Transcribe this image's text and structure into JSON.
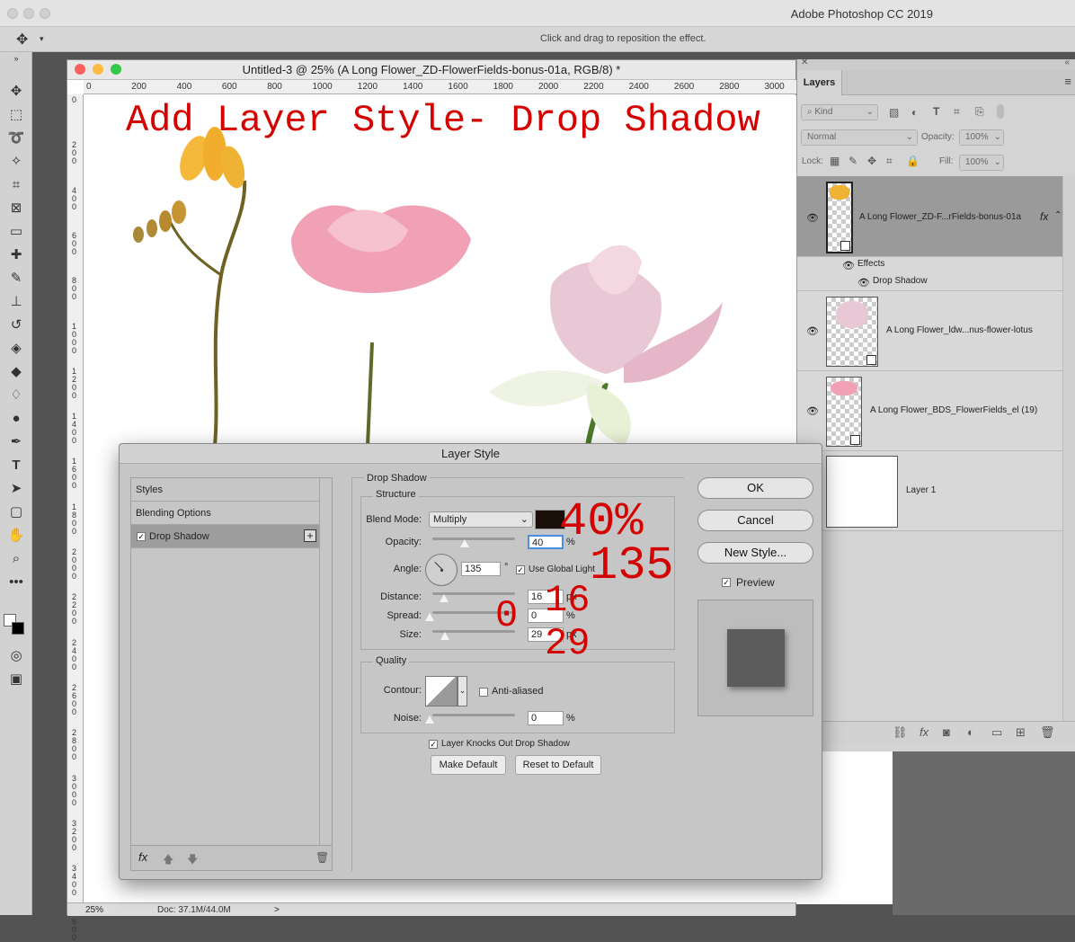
{
  "app": {
    "title": "Adobe Photoshop CC 2019"
  },
  "options_bar": {
    "hint": "Click and drag to reposition the effect."
  },
  "document": {
    "title": "Untitled-3 @ 25% (A Long Flower_ZD-FlowerFields-bonus-01a, RGB/8) *",
    "ruler_h": [
      "0",
      "200",
      "400",
      "600",
      "800",
      "1000",
      "1200",
      "1400",
      "1600",
      "1800",
      "2000",
      "2200",
      "2400",
      "2600",
      "2800",
      "3000"
    ],
    "ruler_v": [
      "0",
      "2 0 0",
      "4 0 0",
      "6 0 0",
      "8 0 0",
      "1 0 0 0",
      "1 2 0 0",
      "1 4 0 0",
      "1 6 0 0",
      "1 8 0 0",
      "2 0 0 0",
      "2 2 0 0",
      "2 4 0 0",
      "2 6 0 0",
      "2 8 0 0",
      "3 0 0 0",
      "3 2 0 0",
      "3 4 0 0",
      "3 6 0 0"
    ],
    "canvas_title": "Add Layer Style- Drop Shadow",
    "zoom": "25%",
    "doc_info": "Doc: 37.1M/44.0M",
    "status_arrow": ">"
  },
  "layers_panel": {
    "tab": "Layers",
    "filter_kind": "Kind",
    "blend_mode": "Normal",
    "opacity_label": "Opacity:",
    "opacity_value": "100%",
    "lock_label": "Lock:",
    "fill_label": "Fill:",
    "fill_value": "100%",
    "layers": [
      {
        "name": "A Long Flower_ZD-F...rFields-bonus-01a",
        "fx": "fx",
        "selected": true
      },
      {
        "name": "A Long Flower_ldw...nus-flower-lotus"
      },
      {
        "name": "A Long Flower_BDS_FlowerFields_el (19)"
      },
      {
        "name": "Layer 1"
      }
    ],
    "effects_label": "Effects",
    "drop_shadow_label": "Drop Shadow"
  },
  "dialog": {
    "title": "Layer Style",
    "styles": [
      "Styles",
      "Blending Options",
      "Drop Shadow"
    ],
    "section": "Drop Shadow",
    "structure": "Structure",
    "blend_mode_label": "Blend Mode:",
    "blend_mode": "Multiply",
    "shadow_color": "#1a0e08",
    "opacity_label": "Opacity:",
    "opacity": "40",
    "angle_label": "Angle:",
    "angle": "135",
    "angle_unit": "°",
    "use_global_light": "Use Global Light",
    "distance_label": "Distance:",
    "distance": "16",
    "distance_unit": "px",
    "spread_label": "Spread:",
    "spread": "0",
    "size_label": "Size:",
    "size": "29",
    "size_unit": "px",
    "percent": "%",
    "quality": "Quality",
    "contour_label": "Contour:",
    "anti_aliased": "Anti-aliased",
    "noise_label": "Noise:",
    "noise": "0",
    "knocks_out": "Layer Knocks Out Drop Shadow",
    "make_default": "Make Default",
    "reset_default": "Reset to Default",
    "ok": "OK",
    "cancel": "Cancel",
    "new_style": "New Style...",
    "preview": "Preview",
    "fx_label": "fx"
  },
  "annotations": {
    "opacity": "40%",
    "angle": "135",
    "distance": "16",
    "spread": "0",
    "size": "29"
  }
}
